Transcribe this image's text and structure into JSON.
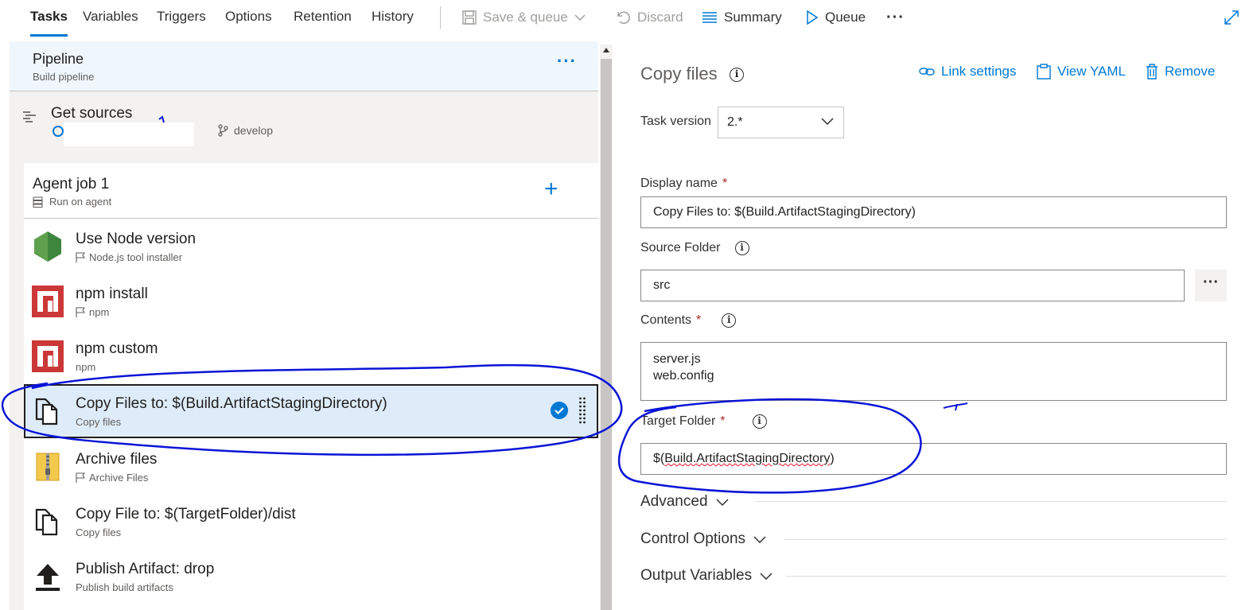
{
  "topbar": {
    "tabs": [
      "Tasks",
      "Variables",
      "Triggers",
      "Options",
      "Retention",
      "History"
    ],
    "save_queue": "Save & queue",
    "discard": "Discard",
    "summary": "Summary",
    "queue": "Queue",
    "more": "···"
  },
  "pipeline": {
    "title": "Pipeline",
    "subtitle": "Build pipeline",
    "more": "···"
  },
  "get_sources": {
    "title": "Get sources",
    "branch": "develop"
  },
  "agent_job": {
    "title": "Agent job 1",
    "subtitle": "Run on agent",
    "add": "+"
  },
  "tasks": [
    {
      "title": "Use Node version",
      "subtitle": "Node.js tool installer",
      "icon": "nodejs-icon"
    },
    {
      "title": "npm install",
      "subtitle": "npm",
      "icon": "npm-icon"
    },
    {
      "title": "npm custom",
      "subtitle": "npm",
      "icon": "npm-icon"
    },
    {
      "title": "Copy Files to: $(Build.ArtifactStagingDirectory)",
      "subtitle": "Copy files",
      "icon": "copy-files-icon"
    },
    {
      "title": "Archive files",
      "subtitle": "Archive Files",
      "icon": "archive-icon"
    },
    {
      "title": "Copy File to: $(TargetFolder)/dist",
      "subtitle": "Copy files",
      "icon": "copy-files-icon"
    },
    {
      "title": "Publish Artifact: drop",
      "subtitle": "Publish build artifacts",
      "icon": "publish-icon"
    }
  ],
  "detail": {
    "title": "Copy files",
    "link_settings": "Link settings",
    "view_yaml": "View YAML",
    "remove": "Remove",
    "task_version_label": "Task version",
    "task_version_value": "2.*",
    "display_name_label": "Display name",
    "display_name_value": "Copy Files to: $(Build.ArtifactStagingDirectory)",
    "source_folder_label": "Source Folder",
    "source_folder_value": "src",
    "source_more": "···",
    "contents_label": "Contents",
    "contents_value": "server.js\nweb.config",
    "target_folder_label": "Target Folder",
    "target_folder_prefix": "$(",
    "target_folder_main": "Build.ArtifactStagingDirectory",
    "target_folder_suffix": ")",
    "required": "*",
    "advanced": "Advanced",
    "control_options": "Control Options",
    "output_variables": "Output Variables"
  },
  "colors": {
    "accent": "#0078d4",
    "npm_red": "#cb3837",
    "node_green": "#5fa04e",
    "annotation": "#0a14d6"
  }
}
